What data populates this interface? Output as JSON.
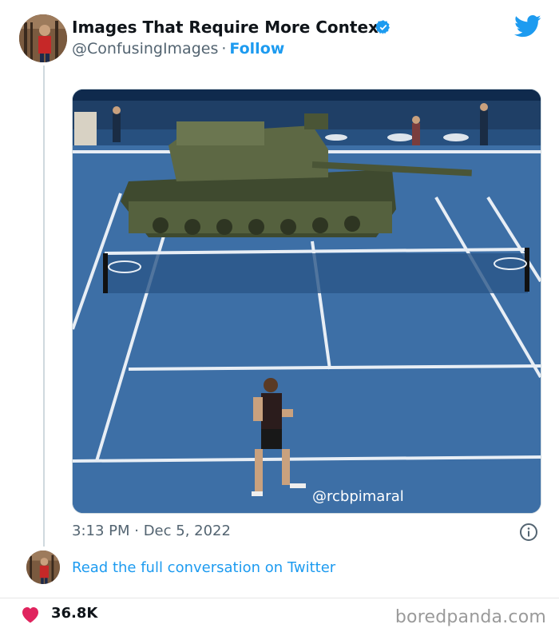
{
  "tweet": {
    "display_name": "Images That Require More Context",
    "handle": "@ConfusingImages",
    "separator": "·",
    "follow_label": "Follow",
    "timestamp": "3:13 PM · Dec 5, 2022",
    "media_watermark": "@rcbpimaral",
    "media_description_icon": "tank-on-tennis-court-image",
    "verified_icon": "verified-badge-icon",
    "platform_icon": "twitter-bird-icon",
    "info_icon": "info-icon"
  },
  "conversation": {
    "link_label": "Read the full conversation on Twitter"
  },
  "footer": {
    "likes": "36.8K",
    "like_icon": "heart-icon",
    "brand": "boredpanda.com"
  },
  "colors": {
    "twitter_blue": "#1d9bf0",
    "heart_red": "#e0245e",
    "court_blue": "#3b6fa8"
  }
}
